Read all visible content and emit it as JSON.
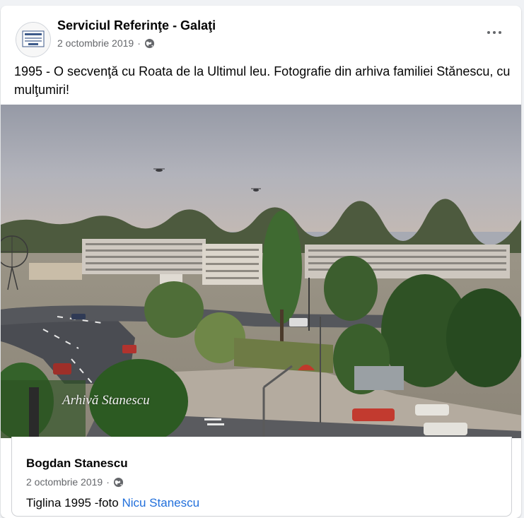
{
  "post": {
    "author": "Serviciul Referinţe - Galaţi",
    "date": "2 octombrie 2019",
    "separator": "·",
    "privacy_icon": "globe-icon",
    "text": "1995 - O secvenţă cu Roata de la Ultimul leu. Fotografie din arhiva familiei Stănescu, cu mulţumiri!",
    "menu_icon": "more-options-icon"
  },
  "photo": {
    "watermark": "Arhivă Stanescu"
  },
  "shared": {
    "author": "Bogdan Stanescu",
    "date": "2 octombrie 2019",
    "separator": "·",
    "privacy_icon": "globe-icon",
    "text_prefix": "Tiglina 1995 -foto ",
    "tagged_name": "Nicu Stanescu"
  },
  "colors": {
    "link": "#216fdb",
    "secondary_text": "#65676b",
    "background": "#f0f2f5"
  }
}
